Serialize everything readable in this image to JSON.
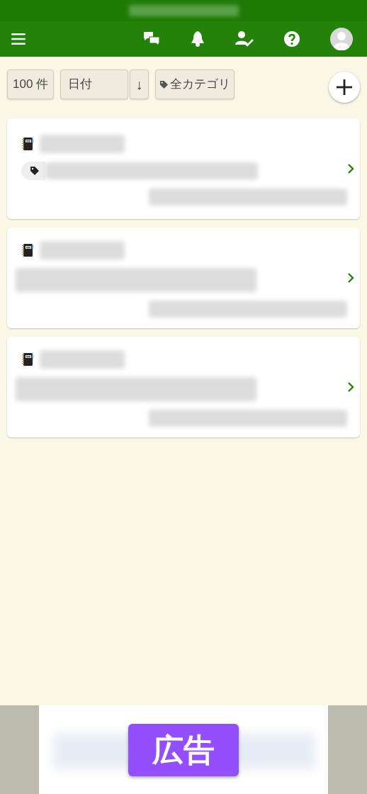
{
  "toolbar": {
    "count": "100 件",
    "sort_field": "日付",
    "sort_direction": "↓",
    "category": "全カテゴリ"
  },
  "cards": [
    {
      "kind": "tagged"
    },
    {
      "kind": "plain"
    },
    {
      "kind": "plain"
    }
  ],
  "ad": {
    "label": "広告"
  }
}
